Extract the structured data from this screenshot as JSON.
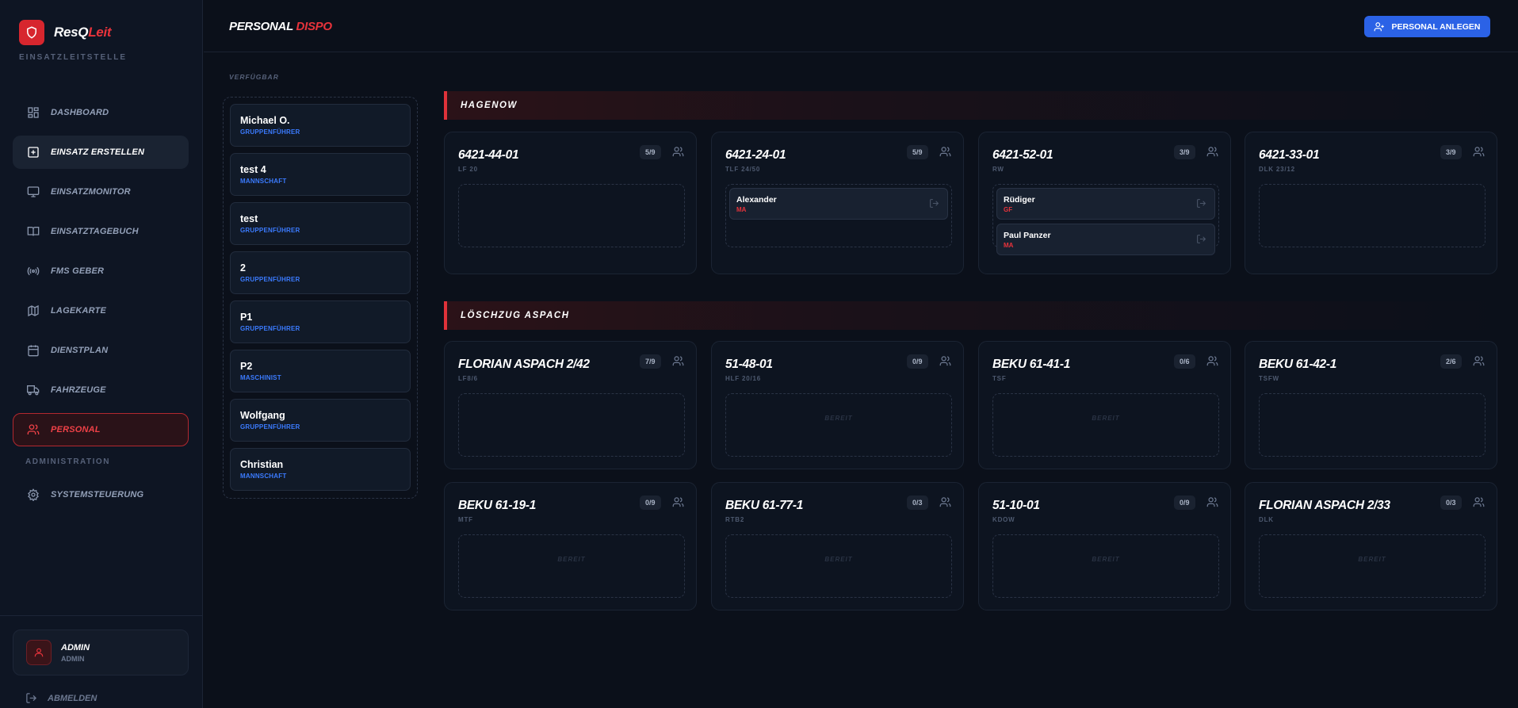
{
  "brand": {
    "name_main": "ResQ",
    "name_accent": "Leit",
    "subtitle": "EINSATZLEITSTELLE"
  },
  "nav": {
    "items": [
      {
        "label": "DASHBOARD",
        "icon": "dashboard-icon"
      },
      {
        "label": "EINSATZ ERSTELLEN",
        "icon": "plus-square-icon"
      },
      {
        "label": "EINSATZMONITOR",
        "icon": "monitor-icon"
      },
      {
        "label": "EINSATZTAGEBUCH",
        "icon": "book-icon"
      },
      {
        "label": "FMS GEBER",
        "icon": "radio-icon"
      },
      {
        "label": "LAGEKARTE",
        "icon": "map-icon"
      },
      {
        "label": "DIENSTPLAN",
        "icon": "calendar-icon"
      },
      {
        "label": "FAHRZEUGE",
        "icon": "truck-icon"
      },
      {
        "label": "PERSONAL",
        "icon": "users-icon"
      }
    ],
    "section_admin": "ADMINISTRATION",
    "admin_items": [
      {
        "label": "SYSTEMSTEUERUNG",
        "icon": "gear-icon"
      }
    ]
  },
  "user": {
    "name": "ADMIN",
    "role": "ADMIN"
  },
  "logout_label": "ABMELDEN",
  "header": {
    "title_main": "PERSONAL",
    "title_accent": "DISPO",
    "add_button": "PERSONAL ANLEGEN"
  },
  "available": {
    "label": "VERFÜGBAR",
    "people": [
      {
        "name": "Michael O.",
        "role": "GRUPPENFÜHRER"
      },
      {
        "name": "test 4",
        "role": "MANNSCHAFT"
      },
      {
        "name": "test",
        "role": "GRUPPENFÜHRER"
      },
      {
        "name": "2",
        "role": "GRUPPENFÜHRER"
      },
      {
        "name": "P1",
        "role": "GRUPPENFÜHRER"
      },
      {
        "name": "P2",
        "role": "MASCHINIST"
      },
      {
        "name": "Wolfgang",
        "role": "GRUPPENFÜHRER"
      },
      {
        "name": "Christian",
        "role": "MANNSCHAFT"
      }
    ]
  },
  "groups": [
    {
      "name": "HAGENOW",
      "vehicles": [
        {
          "name": "6421-44-01",
          "type": "LF 20",
          "count": "5/9",
          "ready": "",
          "crew": []
        },
        {
          "name": "6421-24-01",
          "type": "TLF 24/50",
          "count": "5/9",
          "ready": "",
          "crew": [
            {
              "name": "Alexander",
              "role": "MA"
            }
          ]
        },
        {
          "name": "6421-52-01",
          "type": "RW",
          "count": "3/9",
          "ready": "",
          "crew": [
            {
              "name": "Rüdiger",
              "role": "GF"
            },
            {
              "name": "Paul Panzer",
              "role": "MA"
            }
          ]
        },
        {
          "name": "6421-33-01",
          "type": "DLK 23/12",
          "count": "3/9",
          "ready": "",
          "crew": []
        }
      ]
    },
    {
      "name": "LÖSCHZUG ASPACH",
      "vehicles": [
        {
          "name": "FLORIAN ASPACH 2/42",
          "type": "LF8/6",
          "count": "7/9",
          "ready": "",
          "crew": []
        },
        {
          "name": "51-48-01",
          "type": "HLF 20/16",
          "count": "0/9",
          "ready": "BEREIT",
          "crew": []
        },
        {
          "name": "BEKU 61-41-1",
          "type": "TSF",
          "count": "0/6",
          "ready": "BEREIT",
          "crew": []
        },
        {
          "name": "BEKU 61-42-1",
          "type": "TSFW",
          "count": "2/6",
          "ready": "",
          "crew": []
        },
        {
          "name": "BEKU 61-19-1",
          "type": "MTF",
          "count": "0/9",
          "ready": "BEREIT",
          "crew": []
        },
        {
          "name": "BEKU 61-77-1",
          "type": "RTB2",
          "count": "0/3",
          "ready": "BEREIT",
          "crew": []
        },
        {
          "name": "51-10-01",
          "type": "KDOW",
          "count": "0/9",
          "ready": "BEREIT",
          "crew": []
        },
        {
          "name": "FLORIAN ASPACH 2/33",
          "type": "DLK",
          "count": "0/3",
          "ready": "BEREIT",
          "crew": []
        }
      ]
    }
  ]
}
